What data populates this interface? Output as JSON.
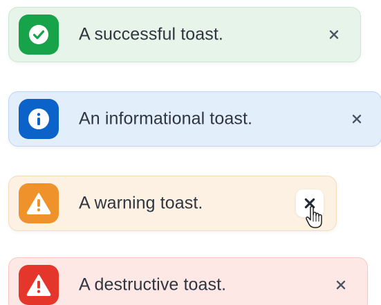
{
  "toasts": [
    {
      "variant": "success",
      "message": "A successful toast.",
      "icon": "check-circle-icon",
      "close_icon": "close-icon",
      "colors": {
        "background": "#e6f4ea",
        "border": "#c9e8d2",
        "badge": "#16a34a"
      }
    },
    {
      "variant": "info",
      "message": "An informational toast.",
      "icon": "info-circle-icon",
      "close_icon": "close-icon",
      "colors": {
        "background": "#e3eefb",
        "border": "#bfd6f3",
        "badge": "#0b63c9"
      }
    },
    {
      "variant": "warning",
      "message": "A warning toast.",
      "icon": "warning-triangle-icon",
      "close_icon": "close-icon",
      "colors": {
        "background": "#fdf1e3",
        "border": "#f6dbb8",
        "badge": "#f0922b"
      }
    },
    {
      "variant": "destructive",
      "message": "A destructive toast.",
      "icon": "warning-triangle-icon",
      "close_icon": "close-icon",
      "colors": {
        "background": "#fde8e6",
        "border": "#f7c9c4",
        "badge": "#e5362b"
      }
    }
  ],
  "cursor": {
    "icon": "hand-pointer-icon"
  }
}
